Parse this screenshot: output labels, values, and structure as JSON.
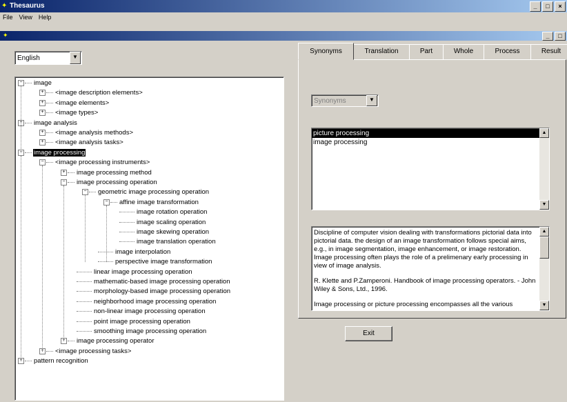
{
  "window": {
    "title": "Thesaurus",
    "menu": [
      "File",
      "View",
      "Help"
    ],
    "controls": [
      "_",
      "□",
      "×"
    ]
  },
  "language": {
    "selected": "English"
  },
  "tree": [
    {
      "label": "image",
      "expander": "minus",
      "indent": 0
    },
    {
      "label": "<image description elements>",
      "expander": "plus",
      "indent": 1
    },
    {
      "label": "<image elements>",
      "expander": "plus",
      "indent": 1
    },
    {
      "label": "<image types>",
      "expander": "plus",
      "indent": 1
    },
    {
      "label": "image analysis",
      "expander": "minus",
      "indent": 0
    },
    {
      "label": "<image analysis methods>",
      "expander": "plus",
      "indent": 1
    },
    {
      "label": "<image analysis tasks>",
      "expander": "plus",
      "indent": 1
    },
    {
      "label": "image processing",
      "expander": "minus",
      "indent": 0,
      "selected": true
    },
    {
      "label": "<image processing instruments>",
      "expander": "minus",
      "indent": 1
    },
    {
      "label": "image processing method",
      "expander": "plus",
      "indent": 2
    },
    {
      "label": "image processing operation",
      "expander": "minus",
      "indent": 2
    },
    {
      "label": "geometric image processing operation",
      "expander": "minus",
      "indent": 3
    },
    {
      "label": "affine image transformation",
      "expander": "minus",
      "indent": 4
    },
    {
      "label": "image rotation operation",
      "expander": "none",
      "indent": 5
    },
    {
      "label": "image scaling operation",
      "expander": "none",
      "indent": 5
    },
    {
      "label": "image skewing operation",
      "expander": "none",
      "indent": 5
    },
    {
      "label": "image translation operation",
      "expander": "none",
      "indent": 5
    },
    {
      "label": "image interpolation",
      "expander": "none",
      "indent": 4
    },
    {
      "label": "perspective image transformation",
      "expander": "none",
      "indent": 4
    },
    {
      "label": "linear image processing operation",
      "expander": "none",
      "indent": 3
    },
    {
      "label": "mathematic-based image processing operation",
      "expander": "none",
      "indent": 3
    },
    {
      "label": "morphology-based image processing operation",
      "expander": "none",
      "indent": 3
    },
    {
      "label": "neighborhood image processing operation",
      "expander": "none",
      "indent": 3
    },
    {
      "label": "non-linear image processing operation",
      "expander": "none",
      "indent": 3
    },
    {
      "label": "point image processing operation",
      "expander": "none",
      "indent": 3
    },
    {
      "label": "smoothing image processing operation",
      "expander": "none",
      "indent": 3
    },
    {
      "label": "image processing operator",
      "expander": "plus",
      "indent": 2
    },
    {
      "label": "<image processing tasks>",
      "expander": "plus",
      "indent": 1
    },
    {
      "label": "pattern recognition",
      "expander": "plus",
      "indent": 0
    }
  ],
  "tabs": [
    {
      "label": "Synonyms",
      "active": true
    },
    {
      "label": "Translation",
      "active": false
    },
    {
      "label": "Part",
      "active": false
    },
    {
      "label": "Whole",
      "active": false
    },
    {
      "label": "Process",
      "active": false
    },
    {
      "label": "Result",
      "active": false
    }
  ],
  "relation_select": {
    "selected": "Synonyms"
  },
  "synonyms": [
    {
      "label": "picture processing",
      "selected": true
    },
    {
      "label": "image processing",
      "selected": false
    }
  ],
  "description": {
    "paragraphs": [
      "Discipline of computer vision dealing with transformations pictorial data into pictorial data. the design of an image transformation  follows special aims, e.g., in image segmentation, image enhancement, or image restoration.  Image processing often plays the role of a prelimenary early processing in view of image analysis.",
      "R. Klette and P.Zamperoni. Handbook of image processing operators. - John Wiley & Sons, Ltd., 1996.",
      "Image processing or picture processing encompasses all the various"
    ]
  },
  "exit_label": "Exit"
}
